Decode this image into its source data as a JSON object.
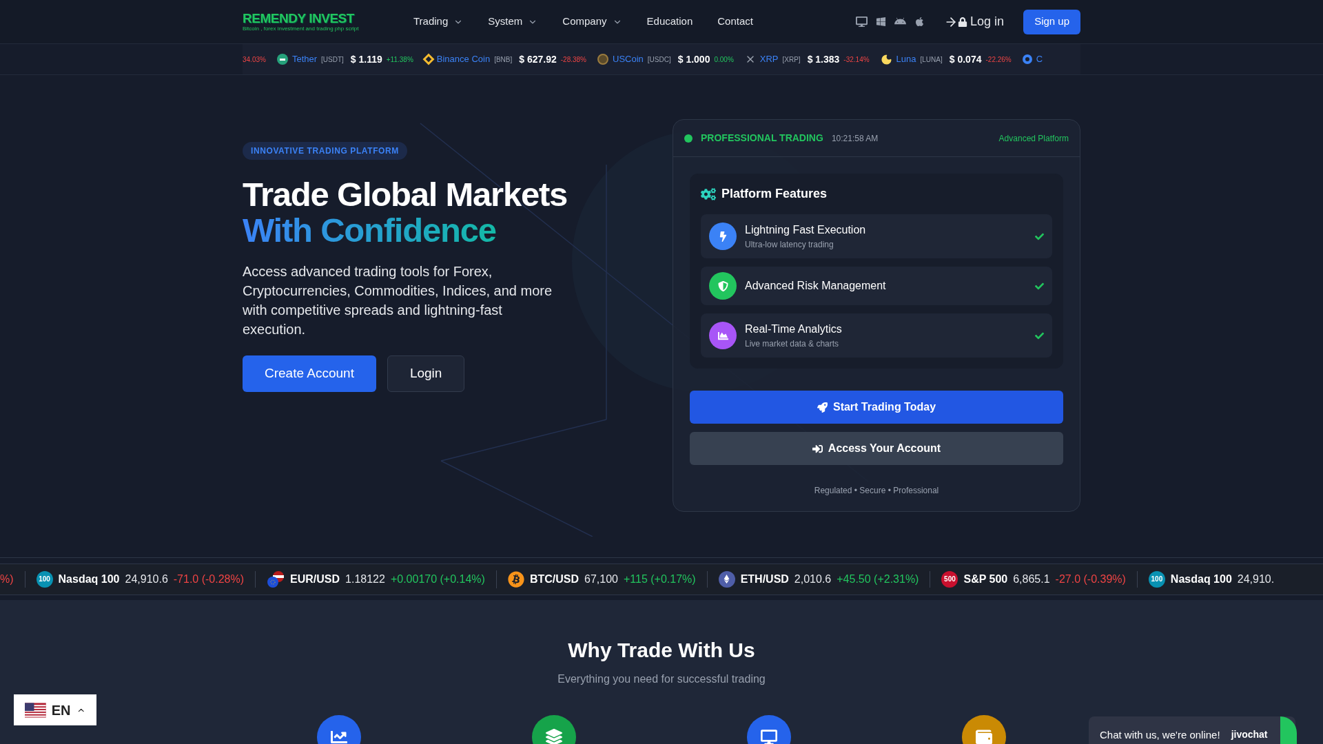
{
  "header": {
    "logo": {
      "name": "REMENDY INVEST",
      "tagline": "Bitcoin , forex investment and trading php script"
    },
    "nav": [
      {
        "label": "Trading",
        "dropdown": true
      },
      {
        "label": "System",
        "dropdown": true
      },
      {
        "label": "Company",
        "dropdown": true
      },
      {
        "label": "Education",
        "dropdown": false
      },
      {
        "label": "Contact",
        "dropdown": false
      }
    ],
    "login": "Log in",
    "signup": "Sign up"
  },
  "crypto_ticker": [
    {
      "change": "34.03%",
      "up": false,
      "kind": "partial"
    },
    {
      "name": "Tether",
      "symbol": "[USDT]",
      "price": "$ 1.119",
      "change": "+11.38%",
      "up": true,
      "kind": "circle",
      "color": "#26a17b"
    },
    {
      "name": "Binance Coin",
      "symbol": "[BNB]",
      "price": "$ 627.92",
      "change": "-28.38%",
      "up": false,
      "kind": "diamond",
      "color": "#f3ba2f"
    },
    {
      "name": "USCoin",
      "symbol": "[USDC]",
      "price": "$ 1.000",
      "change": "0.00%",
      "up": true,
      "kind": "coin",
      "color": "#9a7b3e"
    },
    {
      "name": "XRP",
      "symbol": "[XRP]",
      "price": "$ 1.383",
      "change": "-32.14%",
      "up": false,
      "kind": "cross",
      "color": "#9ca3af"
    },
    {
      "name": "Luna",
      "symbol": "[LUNA]",
      "price": "$ 0.074",
      "change": "-22.26%",
      "up": false,
      "kind": "moon",
      "color": "#f9d85e"
    },
    {
      "name": "C",
      "kind": "gear",
      "color": "#3b82f6"
    }
  ],
  "hero": {
    "badge": "INNOVATIVE TRADING PLATFORM",
    "title": "Trade Global Markets",
    "title_accent": "With Confidence",
    "description": "Access advanced trading tools for Forex, Cryptocurrencies, Commodities, Indices, and more with competitive spreads and lightning-fast execution.",
    "buttons": [
      {
        "label": "Create Account",
        "kind": "primary"
      },
      {
        "label": "Login",
        "kind": "secondary"
      }
    ]
  },
  "card": {
    "status": "PROFESSIONAL TRADING",
    "time": "10:21:58 AM",
    "tag": "Advanced Platform",
    "features_title": "Platform Features",
    "features": [
      {
        "title": "Lightning Fast Execution",
        "subtitle": "Ultra-low latency trading",
        "kind": "bolt",
        "color": "#3b82f6",
        "checked": true
      },
      {
        "title": "Advanced Risk Management",
        "kind": "shield",
        "color": "#22c55e",
        "checked": true
      },
      {
        "title": "Real-Time Analytics",
        "subtitle": "Live market data & charts",
        "kind": "chart",
        "color": "#a855f7",
        "checked": true
      }
    ],
    "buttons": [
      {
        "label": "Start Trading Today",
        "kind": "primary"
      },
      {
        "label": "Access Your Account",
        "kind": "secondary"
      }
    ],
    "footer": "Regulated • Secure • Professional"
  },
  "market_ticker": [
    {
      "change": "%)",
      "up": false,
      "kind": "partial"
    },
    {
      "name": "Nasdaq 100",
      "price": "24,910.6",
      "change": "-71.0 (-0.28%)",
      "up": false,
      "kind": "badge",
      "badge": "100",
      "color": "#0891b2"
    },
    {
      "name": "EUR/USD",
      "price": "1.18122",
      "change": "+0.00170 (+0.14%)",
      "up": true,
      "kind": "flag"
    },
    {
      "name": "BTC/USD",
      "price": "67,100",
      "change": "+115 (+0.17%)",
      "up": true,
      "kind": "bitcoin",
      "color": "#f7931a"
    },
    {
      "name": "ETH/USD",
      "price": "2,010.6",
      "change": "+45.50 (+2.31%)",
      "up": true,
      "kind": "ethereum",
      "color": "#4f5ea8"
    },
    {
      "name": "S&P 500",
      "price": "6,865.1",
      "change": "-27.0 (-0.39%)",
      "up": false,
      "kind": "badge",
      "badge": "500",
      "color": "#c8102e"
    },
    {
      "name": "Nasdaq 100",
      "price": "24,910.",
      "kind": "badge",
      "badge": "100",
      "color": "#0891b2"
    }
  ],
  "why": {
    "title": "Why Trade With Us",
    "subtitle": "Everything you need for successful trading",
    "features": [
      {
        "kind": "chart",
        "color": "#2563eb"
      },
      {
        "kind": "layers",
        "color": "#16a34a"
      },
      {
        "kind": "monitor",
        "color": "#2563eb"
      },
      {
        "kind": "wallet",
        "color": "#ca8a04"
      }
    ]
  },
  "language": {
    "code": "EN"
  },
  "chat": {
    "text": "Chat with us, we're online!",
    "brand": "jivochat"
  }
}
